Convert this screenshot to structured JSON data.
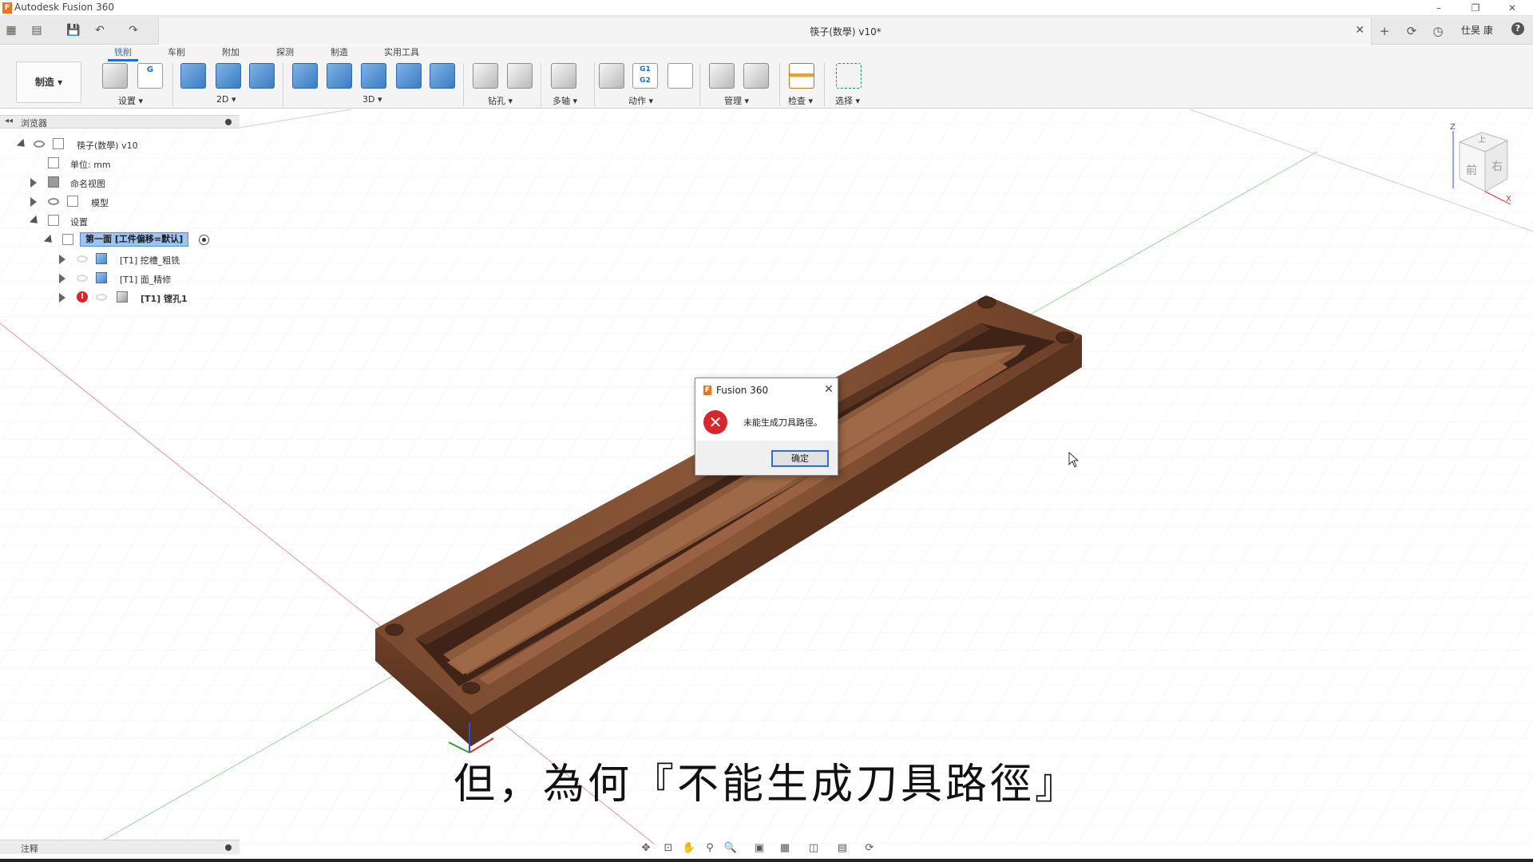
{
  "window": {
    "app_title": "Autodesk Fusion 360",
    "minimize": "–",
    "restore": "❐",
    "close": "✕"
  },
  "document": {
    "title": "筷子(数學) v10*",
    "close": "✕"
  },
  "quick_access": {
    "grid_icon": "▦",
    "file_icon": "▤",
    "save_icon": "💾",
    "undo_icon": "↶",
    "redo_icon": "↷"
  },
  "right_bar": {
    "add_icon": "+",
    "jobs_icon": "⟳",
    "clock_icon": "◷",
    "user_name": "仕昊 康",
    "help_icon": "?"
  },
  "ribbon": {
    "tabs": [
      {
        "label": "铣削",
        "active": true
      },
      {
        "label": "车削",
        "active": false
      },
      {
        "label": "附加",
        "active": false
      },
      {
        "label": "探测",
        "active": false
      },
      {
        "label": "制造",
        "active": false
      },
      {
        "label": "实用工具",
        "active": false
      }
    ],
    "workspace_label": "制造 ▾",
    "groups": [
      {
        "label": "设置 ▾"
      },
      {
        "label": "2D ▾"
      },
      {
        "label": "3D ▾"
      },
      {
        "label": "钻孔 ▾"
      },
      {
        "label": "多轴 ▾"
      },
      {
        "label": "动作 ▾"
      },
      {
        "label": "管理 ▾"
      },
      {
        "label": "检查 ▾"
      },
      {
        "label": "选择 ▾"
      }
    ],
    "g1g2_text": "G1 G2",
    "g_text": "G"
  },
  "browser": {
    "header": "浏览器",
    "collapse_icon": "◂◂",
    "items": [
      {
        "label": "筷子(数學) v10"
      },
      {
        "label": "单位: mm"
      },
      {
        "label": "命名视图"
      },
      {
        "label": "模型"
      },
      {
        "label": "设置"
      },
      {
        "label": "第一面 [工件偏移=默认]"
      },
      {
        "label": "[T1] 挖槽_粗铣"
      },
      {
        "label": "[T1] 面_精修"
      },
      {
        "label": "[T1] 镗孔1"
      }
    ],
    "error_mark": "!"
  },
  "dialog": {
    "title": "Fusion 360",
    "message": "未能生成刀具路徑。",
    "ok_label": "确定",
    "close_icon": "✕",
    "error_glyph": "✕"
  },
  "viewcube": {
    "front": "前",
    "right": "右",
    "top": "上",
    "axis_z": "Z",
    "axis_x": "X"
  },
  "subtitle": "但，為何『不能生成刀具路徑』",
  "comments": {
    "header": "注释"
  },
  "navbar": {
    "orbit_icon": "✥",
    "look_icon": "⊡",
    "pan_icon": "✋",
    "zoom_icon": "⚲",
    "fit_icon": "🔍",
    "display_icon": "▣",
    "grid_icon": "▦",
    "view_icon": "◫",
    "env_icon": "▤",
    "refresh_icon": "⟳"
  }
}
